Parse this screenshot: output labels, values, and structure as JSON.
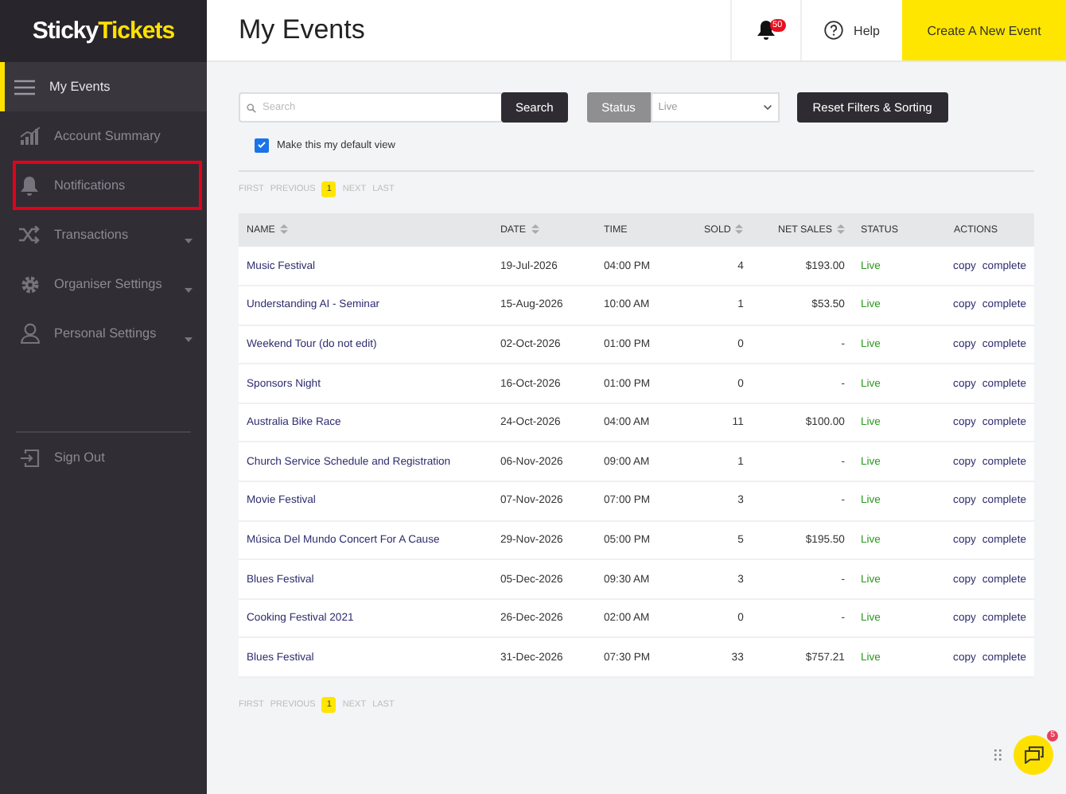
{
  "sidebar": {
    "logo": {
      "part_1": "Sticky",
      "part_2": "Tickets"
    },
    "items": [
      {
        "label": "My Events",
        "selected": true,
        "highlighted": false,
        "has_submenu": false
      },
      {
        "label": "Account Summary",
        "selected": false,
        "highlighted": false,
        "has_submenu": false
      },
      {
        "label": "Notifications",
        "selected": false,
        "highlighted": true,
        "has_submenu": false
      },
      {
        "label": "Transactions",
        "selected": false,
        "highlighted": false,
        "has_submenu": true
      },
      {
        "label": "Organiser Settings",
        "selected": false,
        "highlighted": false,
        "has_submenu": true
      },
      {
        "label": "Personal Settings",
        "selected": false,
        "highlighted": false,
        "has_submenu": true
      }
    ],
    "sign_out": "Sign Out"
  },
  "header": {
    "title": "My Events",
    "notification_count": "50",
    "help": "Help",
    "create_button": "Create A New Event"
  },
  "filters": {
    "search": {
      "placeholder": "Search",
      "button": "Search"
    },
    "status": {
      "label": "Status",
      "value": "Live"
    },
    "reset_button": "Reset Filters & Sorting",
    "default_view": {
      "label": "Make this my default view",
      "checked": true
    }
  },
  "pager_top": {
    "first": "FIRST",
    "previous": "PREVIOUS",
    "pages": [
      {
        "label": "1",
        "selected": true
      }
    ],
    "next": "NEXT",
    "last": "LAST"
  },
  "table": {
    "columns": [
      {
        "label": "NAME",
        "sortable": true
      },
      {
        "label": "DATE",
        "sortable": true
      },
      {
        "label": "TIME",
        "sortable": false
      },
      {
        "label": "SOLD",
        "sortable": true
      },
      {
        "label": "NET SALES",
        "sortable": true
      },
      {
        "label": "STATUS",
        "sortable": false
      },
      {
        "label": "ACTIONS",
        "sortable": false
      }
    ],
    "rows": [
      {
        "name": "Music Festival",
        "date": "19-Jul-2026",
        "time": "04:00 PM",
        "sold": "4",
        "net_sales": "$193.00",
        "status": "Live",
        "actions": [
          "copy",
          "complete"
        ]
      },
      {
        "name": "Understanding AI - Seminar",
        "date": "15-Aug-2026",
        "time": "10:00 AM",
        "sold": "1",
        "net_sales": "$53.50",
        "status": "Live",
        "actions": [
          "copy",
          "complete"
        ]
      },
      {
        "name": "Weekend Tour (do not edit)",
        "date": "02-Oct-2026",
        "time": "01:00 PM",
        "sold": "0",
        "net_sales": "-",
        "status": "Live",
        "actions": [
          "copy",
          "complete"
        ]
      },
      {
        "name": "Sponsors Night",
        "date": "16-Oct-2026",
        "time": "01:00 PM",
        "sold": "0",
        "net_sales": "-",
        "status": "Live",
        "actions": [
          "copy",
          "complete"
        ]
      },
      {
        "name": "Australia Bike Race",
        "date": "24-Oct-2026",
        "time": "04:00 AM",
        "sold": "11",
        "net_sales": "$100.00",
        "status": "Live",
        "actions": [
          "copy",
          "complete"
        ]
      },
      {
        "name": "Church Service Schedule and Registration",
        "date": "06-Nov-2026",
        "time": "09:00 AM",
        "sold": "1",
        "net_sales": "-",
        "status": "Live",
        "actions": [
          "copy",
          "complete"
        ]
      },
      {
        "name": "Movie Festival",
        "date": "07-Nov-2026",
        "time": "07:00 PM",
        "sold": "3",
        "net_sales": "-",
        "status": "Live",
        "actions": [
          "copy",
          "complete"
        ]
      },
      {
        "name": "Música Del Mundo Concert For A Cause",
        "date": "29-Nov-2026",
        "time": "05:00 PM",
        "sold": "5",
        "net_sales": "$195.50",
        "status": "Live",
        "actions": [
          "copy",
          "complete"
        ]
      },
      {
        "name": "Blues Festival",
        "date": "05-Dec-2026",
        "time": "09:30 AM",
        "sold": "3",
        "net_sales": "-",
        "status": "Live",
        "actions": [
          "copy",
          "complete"
        ]
      },
      {
        "name": "Cooking Festival 2021",
        "date": "26-Dec-2026",
        "time": "02:00 AM",
        "sold": "0",
        "net_sales": "-",
        "status": "Live",
        "actions": [
          "copy",
          "complete"
        ]
      },
      {
        "name": "Blues Festival",
        "date": "31-Dec-2026",
        "time": "07:30 PM",
        "sold": "33",
        "net_sales": "$757.21",
        "status": "Live",
        "actions": [
          "copy",
          "complete"
        ]
      }
    ]
  },
  "pager_bottom": {
    "first": "FIRST",
    "previous": "PREVIOUS",
    "pages": [
      {
        "label": "1",
        "selected": true
      }
    ],
    "next": "NEXT",
    "last": "LAST"
  },
  "chat": {
    "badge": "5"
  }
}
